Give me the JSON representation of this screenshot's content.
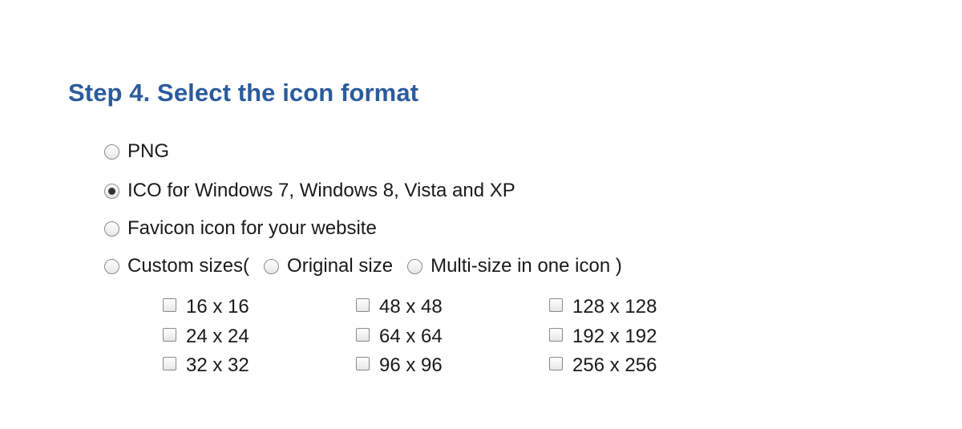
{
  "heading": "Step 4. Select the icon format",
  "formats": [
    {
      "label": "PNG",
      "checked": false
    },
    {
      "label": "ICO for Windows 7, Windows 8, Vista and XP",
      "checked": true
    },
    {
      "label": "Favicon icon for your website",
      "checked": false
    }
  ],
  "custom": {
    "prefix": "Custom sizes(",
    "original_label": "Original size",
    "multi_label": "Multi-size in one icon )"
  },
  "sizes": {
    "col1": [
      "16 x 16",
      "24 x 24",
      "32 x 32"
    ],
    "col2": [
      "48 x 48",
      "64 x 64",
      "96 x 96"
    ],
    "col3": [
      "128 x 128",
      "192 x 192",
      "256 x 256"
    ]
  }
}
